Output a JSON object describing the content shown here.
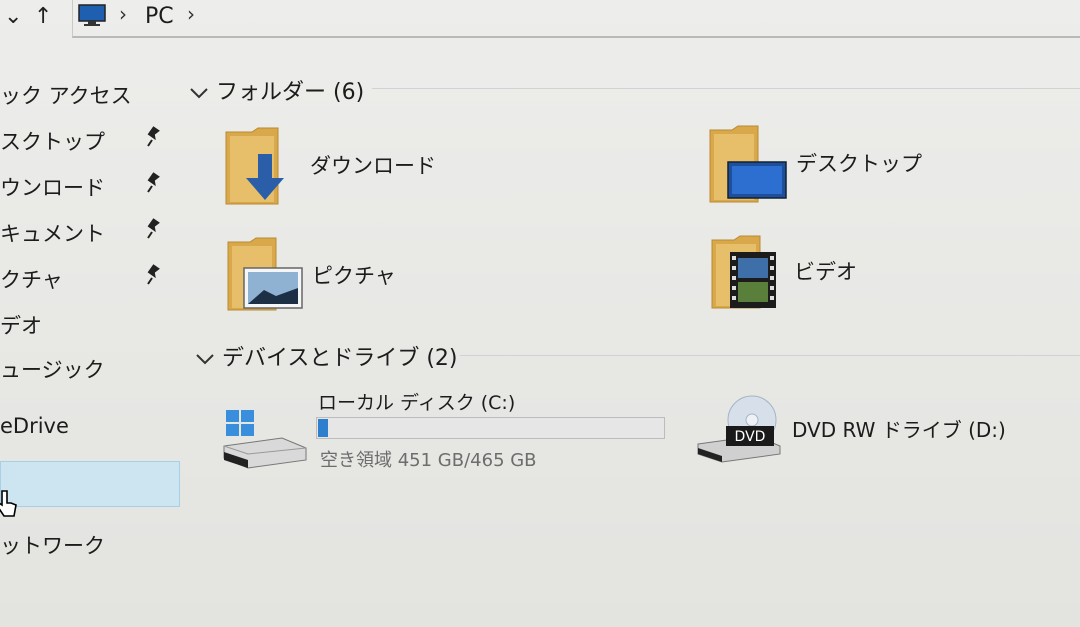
{
  "addressbar": {
    "breadcrumb": [
      "PC"
    ]
  },
  "sidebar": {
    "items": [
      {
        "label": "ック アクセス",
        "pinned": false
      },
      {
        "label": "スクトップ",
        "pinned": true
      },
      {
        "label": "ウンロード",
        "pinned": true
      },
      {
        "label": "キュメント",
        "pinned": true
      },
      {
        "label": "クチャ",
        "pinned": true
      },
      {
        "label": "デオ",
        "pinned": false
      },
      {
        "label": "ュージック",
        "pinned": false
      },
      {
        "label": "eDrive",
        "pinned": false
      },
      {
        "label": "",
        "pinned": false,
        "selected": true
      },
      {
        "label": "ットワーク",
        "pinned": false
      }
    ]
  },
  "folders": {
    "header": "フォルダー (6)",
    "items": [
      {
        "label": "ダウンロード",
        "icon": "downloads-folder-icon"
      },
      {
        "label": "デスクトップ",
        "icon": "desktop-folder-icon"
      },
      {
        "label": "ピクチャ",
        "icon": "pictures-folder-icon"
      },
      {
        "label": "ビデオ",
        "icon": "videos-folder-icon"
      }
    ]
  },
  "devices": {
    "header": "デバイスとドライブ (2)",
    "local_disk": {
      "name": "ローカル ディスク (C:)",
      "free_text": "空き領域 451 GB/465 GB",
      "used_fraction": 0.03,
      "icon": "windows-drive-icon"
    },
    "dvd": {
      "name": "DVD RW ドライブ (D:)",
      "badge": "DVD",
      "icon": "dvd-drive-icon"
    }
  },
  "colors": {
    "folder": "#d9a84a",
    "accent": "#2f7fcf",
    "selection": "#cde4f1"
  }
}
